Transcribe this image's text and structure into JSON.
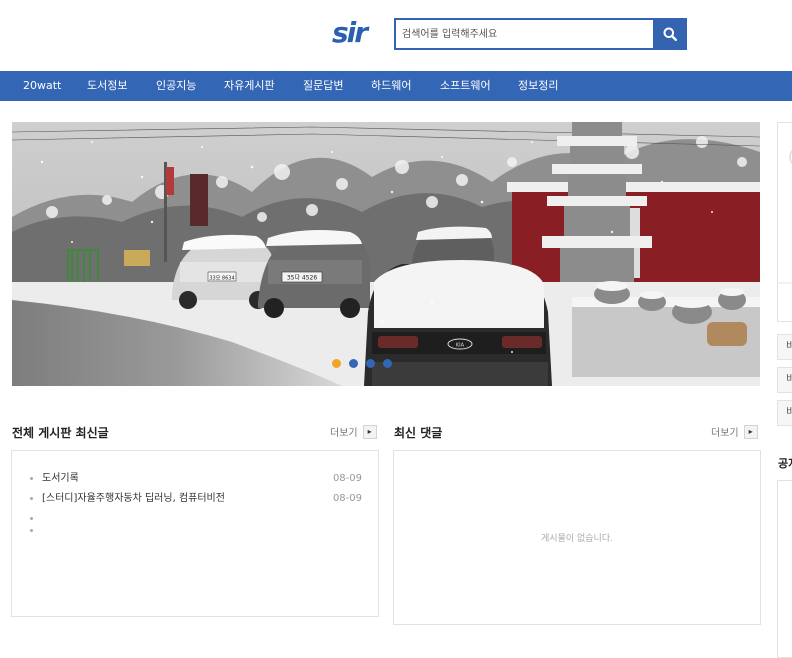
{
  "header": {
    "logo_text": "sir",
    "search": {
      "placeholder": "검색어를 입력해주세요",
      "value": ""
    }
  },
  "nav": {
    "items": [
      {
        "label": "20watt"
      },
      {
        "label": "도서정보"
      },
      {
        "label": "인공지능"
      },
      {
        "label": "자유게시판"
      },
      {
        "label": "질문답변"
      },
      {
        "label": "하드웨어"
      },
      {
        "label": "소프트웨어"
      },
      {
        "label": "정보정리"
      }
    ]
  },
  "slider": {
    "total_slides": 4,
    "active_slide": 1,
    "car_plates": [
      "33모 8634",
      "35다 4526"
    ]
  },
  "side": {
    "buttons": [
      "비",
      "비",
      "비"
    ],
    "title": "공지"
  },
  "latest_posts": {
    "title": "전체 게시판 최신글",
    "more_label": "더보기",
    "items": [
      {
        "subject": "도서기록",
        "date": "08-09"
      },
      {
        "subject": "[스터디]자율주행자동차 딥러닝, 컴퓨터비전",
        "date": "08-09"
      }
    ]
  },
  "latest_comments": {
    "title": "최신 댓글",
    "more_label": "더보기",
    "empty_message": "게시물이 없습니다."
  },
  "colors": {
    "brand_blue": "#3466b6",
    "search_blue": "#3363b1",
    "dot_active": "#f0a526",
    "logo": "#2a5fb2"
  }
}
